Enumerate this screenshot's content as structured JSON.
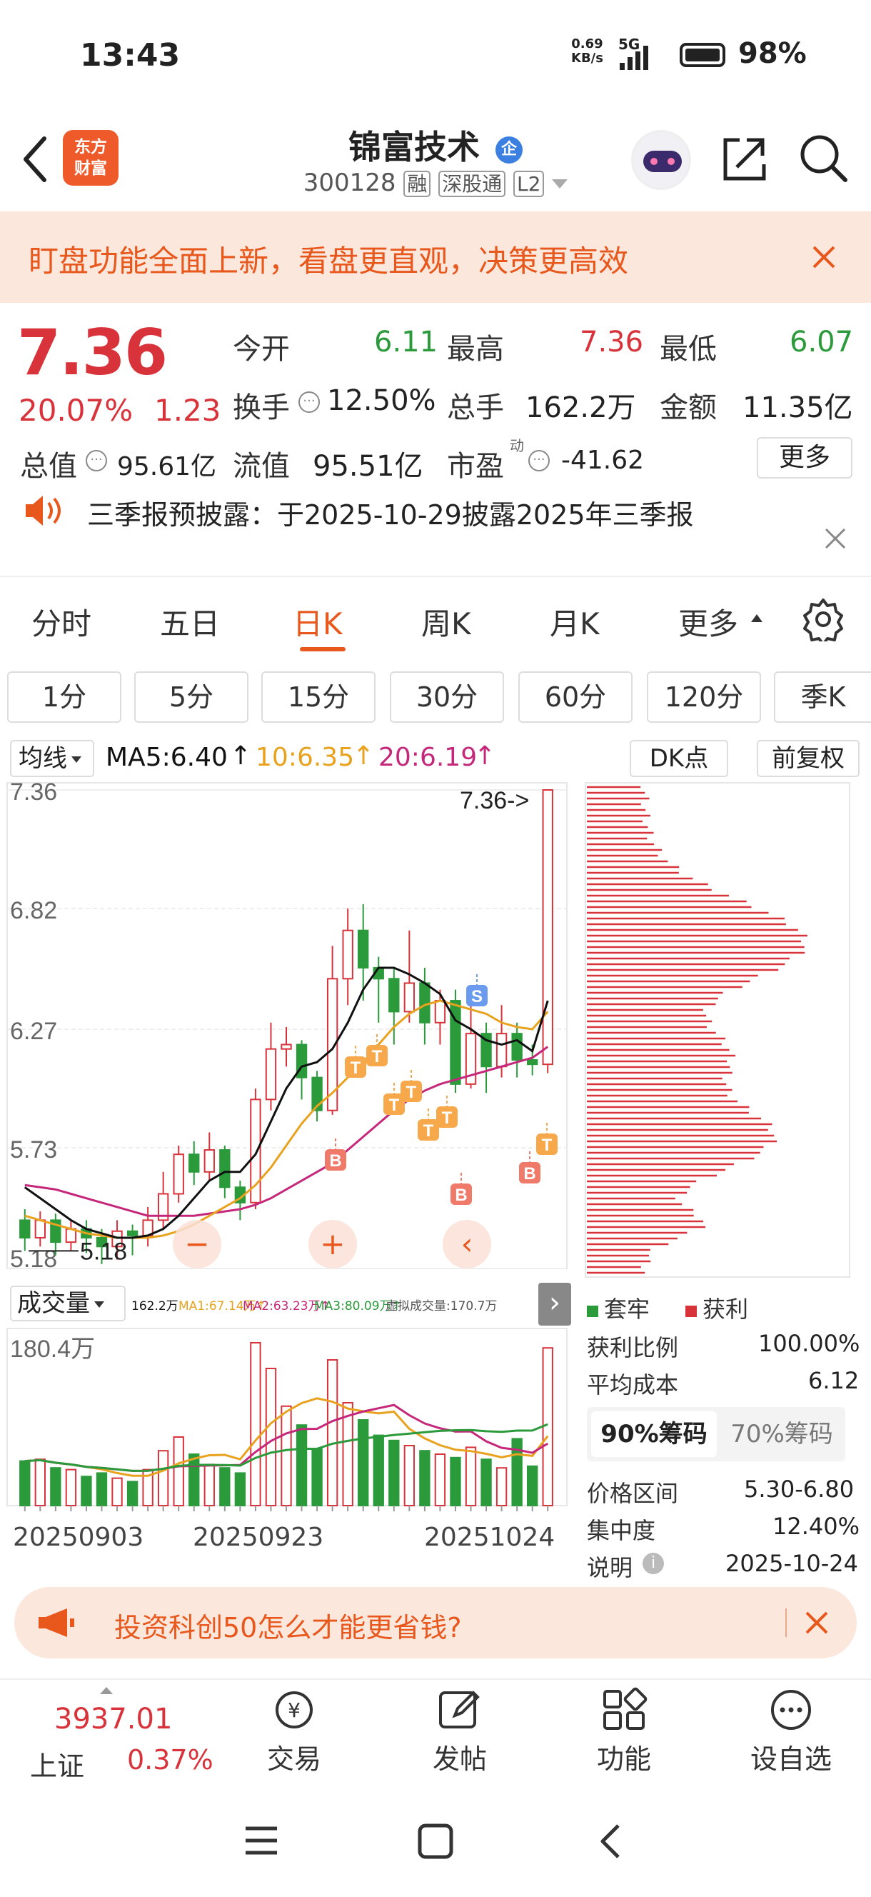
{
  "status": {
    "time": "13:43",
    "net_speed": "0.69",
    "net_unit": "KB/s",
    "network": "5G",
    "battery": "98%"
  },
  "header": {
    "logo": "东方财富",
    "name": "锦富技术",
    "badge": "企",
    "code": "300128",
    "tags": [
      "融",
      "深股通",
      "L2"
    ]
  },
  "banner": {
    "text": "盯盘功能全面上新，看盘更直观，决策更高效"
  },
  "quote": {
    "price": "7.36",
    "change_pct": "20.07%",
    "change": "1.23",
    "open_label": "今开",
    "open": "6.11",
    "high_label": "最高",
    "high": "7.36",
    "low_label": "最低",
    "low": "6.07",
    "turnover_label": "换手",
    "turnover": "12.50%",
    "volume_label": "总手",
    "volume": "162.2万",
    "amount_label": "金额",
    "amount": "11.35亿",
    "mcap_label": "总值",
    "mcap": "95.61亿",
    "float_label": "流值",
    "float": "95.51亿",
    "pe_label": "市盈",
    "pe_sup": "动",
    "pe": "-41.62",
    "more": "更多"
  },
  "notice": {
    "text": "三季报预披露：于2025-10-29披露2025年三季报"
  },
  "period_tabs": [
    "分时",
    "五日",
    "日K",
    "周K",
    "月K",
    "更多"
  ],
  "minute_tabs": [
    "1分",
    "5分",
    "15分",
    "30分",
    "60分",
    "120分",
    "季K"
  ],
  "ma_bar": {
    "selector": "均线",
    "ma5": "MA5:6.40",
    "ma10": "10:6.35",
    "ma20": "20:6.19",
    "dk": "DK点",
    "adjust": "前复权"
  },
  "colors": {
    "up": "#d8323a",
    "down": "#2a9a3a",
    "accent": "#e8571c",
    "ma5": "#111111",
    "ma10": "#e8a21e",
    "ma20": "#c5287a"
  },
  "chart_data": {
    "type": "candlestick",
    "y_ticks": [
      "7.36",
      "6.82",
      "6.27",
      "5.73",
      "5.18"
    ],
    "ylim": [
      5.18,
      7.36
    ],
    "last_price_label": "7.36->",
    "low_label": "5.18",
    "x_labels": [
      "20250903",
      "20250923",
      "20251024"
    ],
    "candles": [
      [
        5.4,
        5.32,
        5.45,
        5.26
      ],
      [
        5.32,
        5.4,
        5.44,
        5.28
      ],
      [
        5.4,
        5.3,
        5.43,
        5.24
      ],
      [
        5.3,
        5.36,
        5.4,
        5.26
      ],
      [
        5.36,
        5.32,
        5.4,
        5.25
      ],
      [
        5.32,
        5.28,
        5.36,
        5.2
      ],
      [
        5.28,
        5.35,
        5.4,
        5.22
      ],
      [
        5.35,
        5.33,
        5.38,
        5.24
      ],
      [
        5.33,
        5.4,
        5.46,
        5.28
      ],
      [
        5.4,
        5.52,
        5.62,
        5.36
      ],
      [
        5.52,
        5.7,
        5.74,
        5.48
      ],
      [
        5.7,
        5.62,
        5.76,
        5.56
      ],
      [
        5.62,
        5.72,
        5.8,
        5.58
      ],
      [
        5.72,
        5.55,
        5.74,
        5.5
      ],
      [
        5.55,
        5.48,
        5.58,
        5.4
      ],
      [
        5.48,
        5.95,
        6.0,
        5.45
      ],
      [
        5.95,
        6.18,
        6.3,
        5.9
      ],
      [
        6.18,
        6.2,
        6.28,
        6.1
      ],
      [
        6.2,
        6.05,
        6.22,
        5.95
      ],
      [
        6.05,
        5.9,
        6.08,
        5.85
      ],
      [
        5.9,
        6.5,
        6.65,
        5.88
      ],
      [
        6.5,
        6.72,
        6.82,
        6.38
      ],
      [
        6.72,
        6.55,
        6.84,
        6.4
      ],
      [
        6.55,
        6.5,
        6.6,
        6.3
      ],
      [
        6.5,
        6.35,
        6.55,
        6.2
      ],
      [
        6.35,
        6.48,
        6.72,
        6.3
      ],
      [
        6.48,
        6.3,
        6.55,
        6.2
      ],
      [
        6.3,
        6.4,
        6.45,
        6.2
      ],
      [
        6.4,
        6.02,
        6.45,
        5.98
      ],
      [
        6.02,
        6.25,
        6.4,
        6.0
      ],
      [
        6.25,
        6.1,
        6.3,
        5.98
      ],
      [
        6.1,
        6.25,
        6.38,
        6.05
      ],
      [
        6.25,
        6.13,
        6.3,
        6.05
      ],
      [
        6.13,
        6.11,
        6.2,
        6.06
      ],
      [
        6.11,
        7.36,
        7.36,
        6.07
      ]
    ],
    "ma5": [
      5.55,
      5.5,
      5.45,
      5.4,
      5.36,
      5.34,
      5.32,
      5.32,
      5.33,
      5.36,
      5.42,
      5.5,
      5.58,
      5.62,
      5.62,
      5.7,
      5.85,
      6.0,
      6.1,
      6.12,
      6.18,
      6.3,
      6.45,
      6.55,
      6.55,
      6.52,
      6.48,
      6.43,
      6.31,
      6.27,
      6.22,
      6.2,
      6.22,
      6.17,
      6.4
    ],
    "ma10": [
      5.42,
      5.4,
      5.38,
      5.36,
      5.34,
      5.33,
      5.32,
      5.32,
      5.32,
      5.33,
      5.35,
      5.38,
      5.42,
      5.46,
      5.5,
      5.56,
      5.64,
      5.74,
      5.84,
      5.92,
      5.98,
      6.05,
      6.12,
      6.2,
      6.28,
      6.34,
      6.38,
      6.4,
      6.38,
      6.36,
      6.34,
      6.3,
      6.28,
      6.27,
      6.35
    ],
    "ma20": [
      5.56,
      5.55,
      5.54,
      5.52,
      5.5,
      5.48,
      5.46,
      5.44,
      5.42,
      5.42,
      5.42,
      5.42,
      5.43,
      5.44,
      5.45,
      5.47,
      5.5,
      5.54,
      5.58,
      5.62,
      5.66,
      5.72,
      5.78,
      5.84,
      5.9,
      5.95,
      5.99,
      6.02,
      6.04,
      6.06,
      6.08,
      6.1,
      6.12,
      6.14,
      6.19
    ]
  },
  "volume_bar": {
    "label": "成交量",
    "vol": "162.2万",
    "ma1": "MA1:67.14万↑",
    "ma2": "MA2:63.23万↑",
    "ma3": "MA3:80.09万↑",
    "virtual": "虚拟成交量:170.7万",
    "max_label": "180.4万",
    "values": [
      0.26,
      0.27,
      0.22,
      0.21,
      0.17,
      0.19,
      0.16,
      0.14,
      0.21,
      0.32,
      0.4,
      0.3,
      0.24,
      0.22,
      0.19,
      0.95,
      0.8,
      0.58,
      0.47,
      0.33,
      0.85,
      0.6,
      0.5,
      0.41,
      0.38,
      0.35,
      0.32,
      0.3,
      0.28,
      0.34,
      0.27,
      0.22,
      0.39,
      0.23,
      0.92
    ]
  },
  "chip": {
    "legend_trapped": "套牢",
    "legend_profit": "获利",
    "profit_ratio_label": "获利比例",
    "profit_ratio": "100.00%",
    "avg_cost_label": "平均成本",
    "avg_cost": "6.12",
    "tab90": "90%筹码",
    "tab70": "70%筹码",
    "range_label": "价格区间",
    "range": "5.30-6.80",
    "concentration_label": "集中度",
    "concentration": "12.40%",
    "note_label": "说明",
    "note_date": "2025-10-24"
  },
  "ad": {
    "text": "投资科创50怎么才能更省钱?"
  },
  "bottom": {
    "index_value": "3937.01",
    "index_name": "上证",
    "index_change": "0.37%",
    "trade": "交易",
    "post": "发帖",
    "func": "功能",
    "watch": "设自选"
  }
}
